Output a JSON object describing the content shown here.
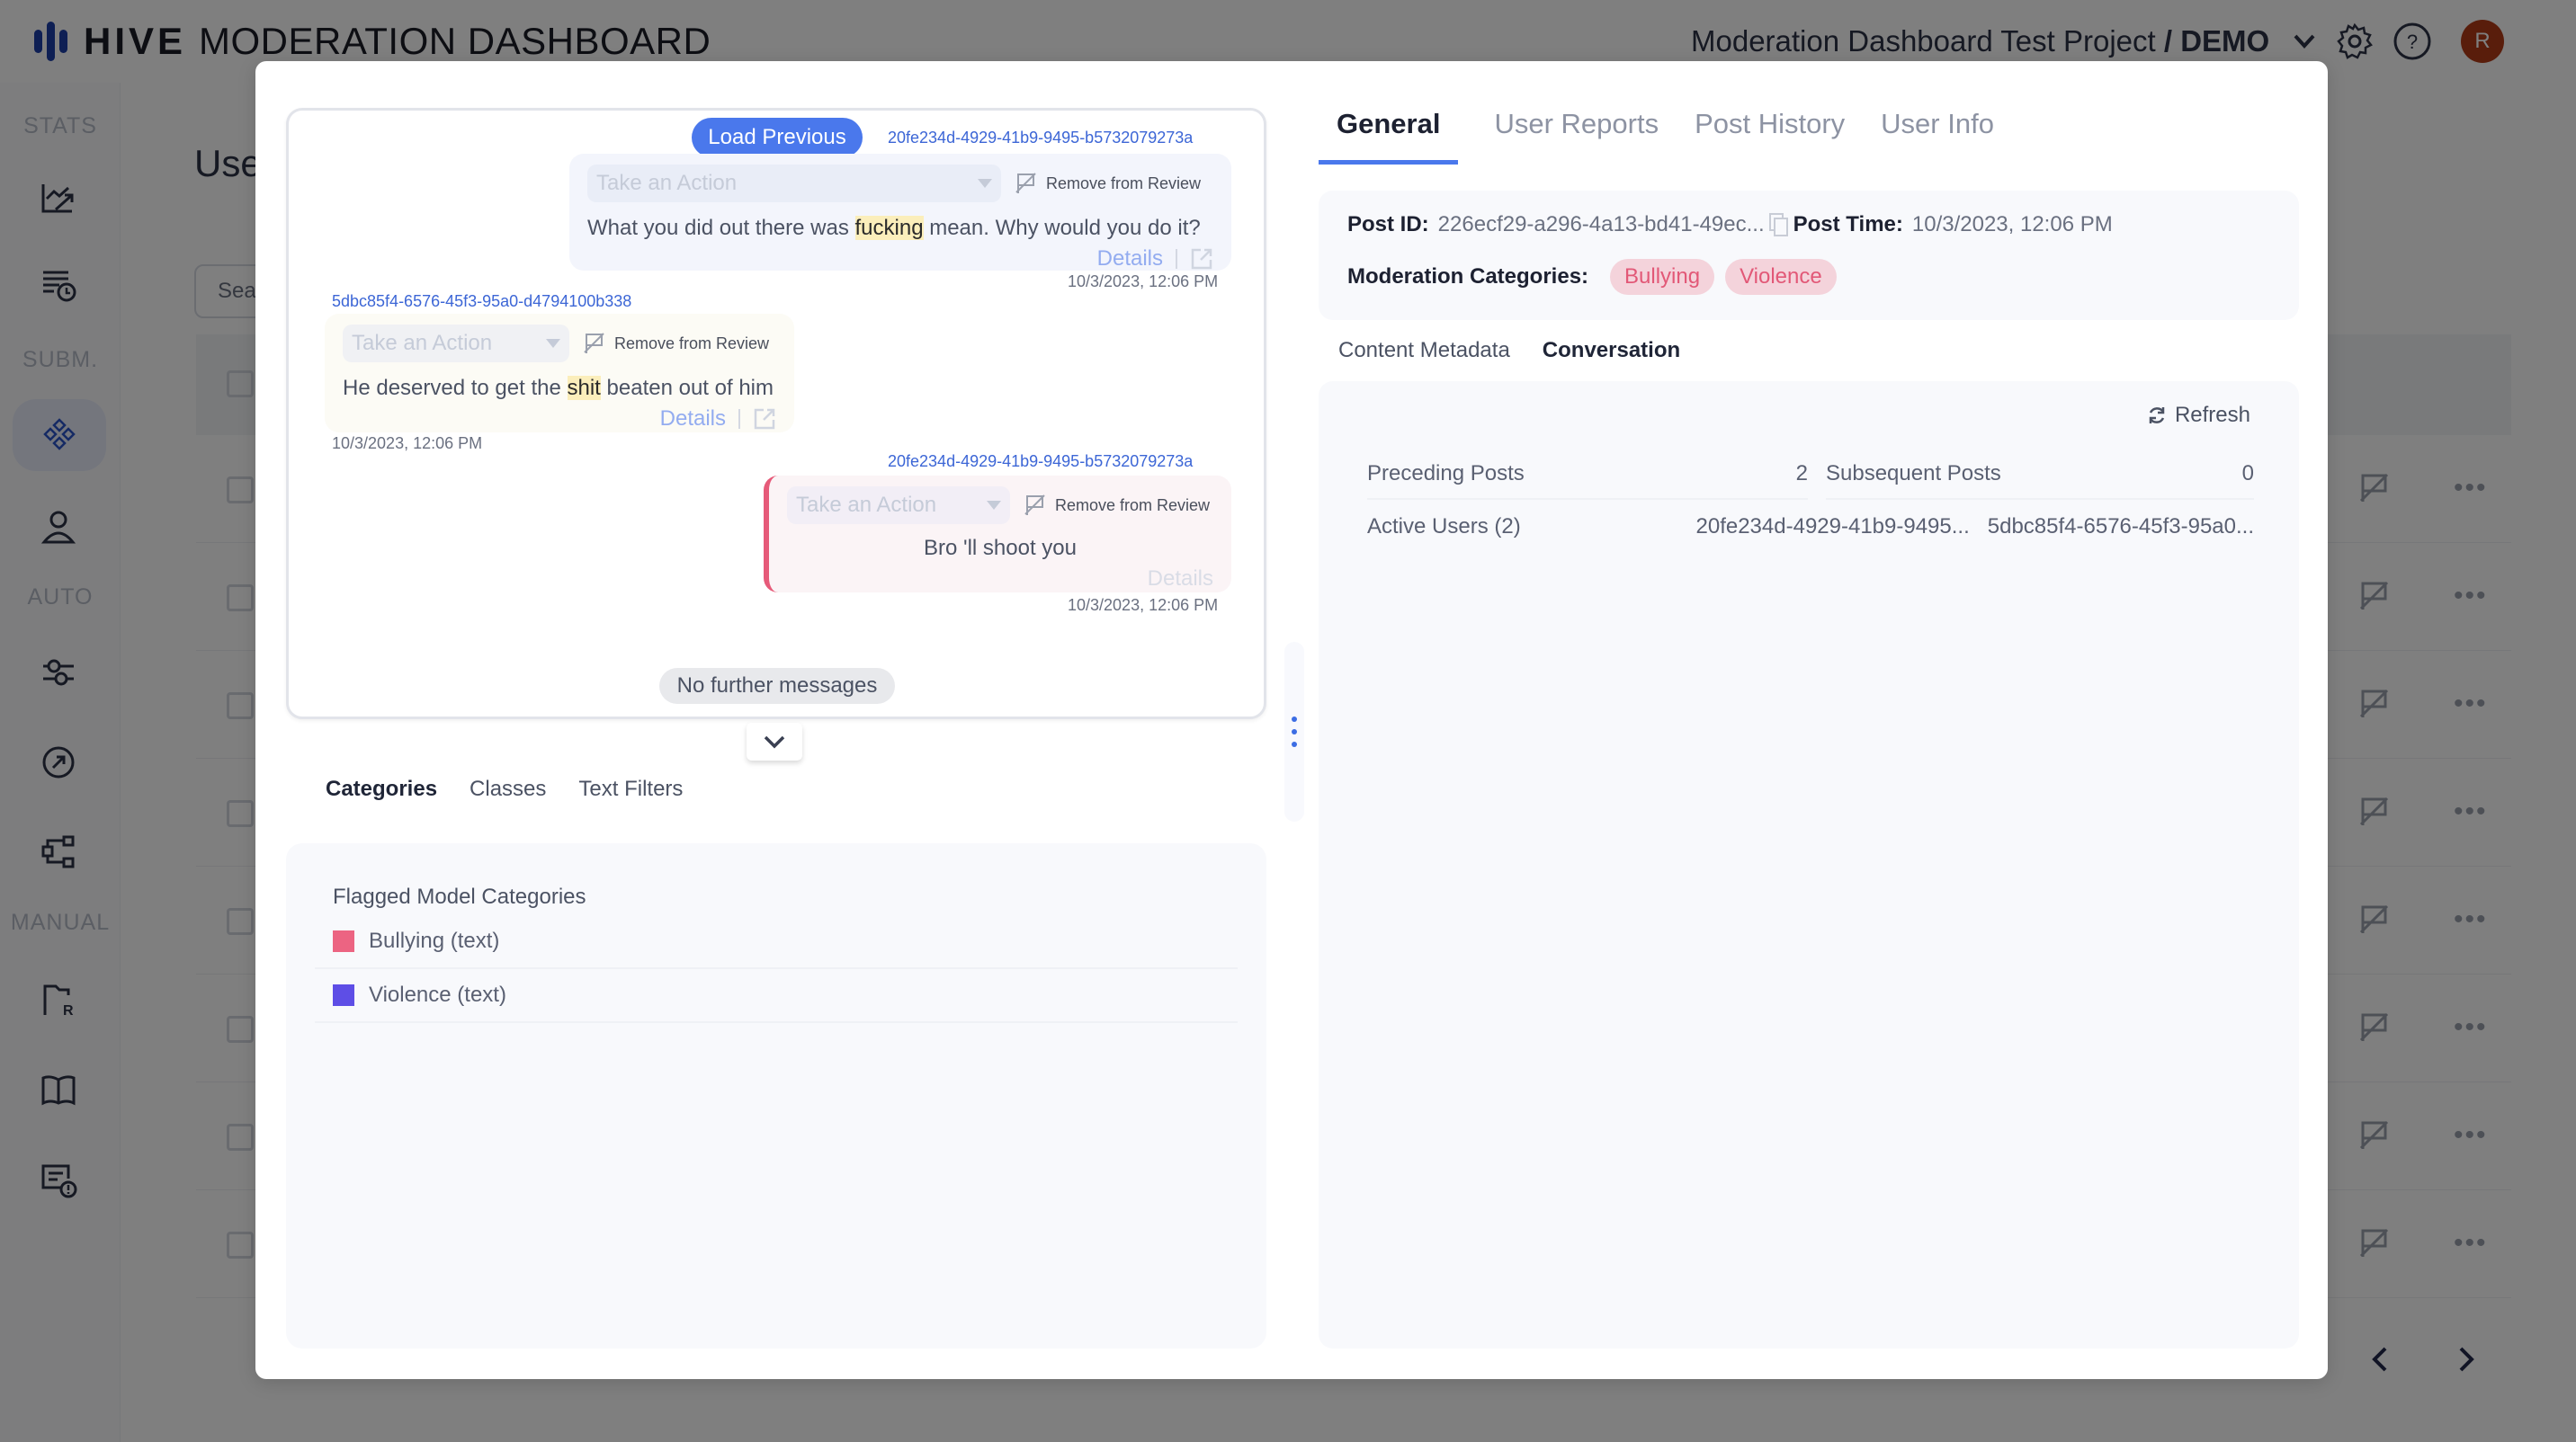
{
  "header": {
    "brand": "HIVE",
    "title": "MODERATION DASHBOARD",
    "project_name": "Moderation Dashboard Test Project",
    "project_separator": " / ",
    "project_env": "DEMO",
    "avatar_initial": "R",
    "avatar_color": "#b23a16"
  },
  "sidebar": {
    "sections": [
      {
        "label": "STATS",
        "items": [
          {
            "icon": "trend-chart-icon"
          },
          {
            "icon": "list-clock-icon"
          }
        ]
      },
      {
        "label": "SUBM.",
        "items": [
          {
            "icon": "diamonds-icon",
            "active": true
          },
          {
            "icon": "user-icon"
          }
        ]
      },
      {
        "label": "AUTO",
        "items": [
          {
            "icon": "sliders-icon"
          },
          {
            "icon": "arrow-circle-icon"
          },
          {
            "icon": "workflow-icon"
          }
        ]
      },
      {
        "label": "MANUAL",
        "items": [
          {
            "icon": "folder-r-icon"
          },
          {
            "icon": "book-icon"
          },
          {
            "icon": "report-alert-icon"
          }
        ]
      }
    ]
  },
  "background_page": {
    "title": "Use",
    "search_placeholder": "Sea"
  },
  "conversation": {
    "load_previous": "Load Previous",
    "messages": [
      {
        "user_id": "20fe234d-4929-41b9-9495-b5732079273a",
        "action_placeholder": "Take an Action",
        "remove_label": "Remove from Review",
        "text_before": "What you did out there was ",
        "highlight": "fucking",
        "text_after": " mean. Why would you do it?",
        "details": "Details",
        "timestamp": "10/3/2023, 12:06 PM",
        "side": "right"
      },
      {
        "user_id": "5dbc85f4-6576-45f3-95a0-d4794100b338",
        "action_placeholder": "Take an Action",
        "remove_label": "Remove from Review",
        "text_before": "He deserved to get the ",
        "highlight": "shit",
        "text_after": " beaten out of him",
        "details": "Details",
        "timestamp": "10/3/2023, 12:06 PM",
        "side": "left"
      },
      {
        "user_id": "20fe234d-4929-41b9-9495-b5732079273a",
        "action_placeholder": "Take an Action",
        "remove_label": "Remove from Review",
        "text": "Bro 'll shoot you",
        "details": "Details",
        "timestamp": "10/3/2023, 12:06 PM",
        "side": "right",
        "current": true
      }
    ],
    "no_more": "No further messages"
  },
  "left_tabs": [
    {
      "label": "Categories",
      "active": true
    },
    {
      "label": "Classes"
    },
    {
      "label": "Text Filters"
    }
  ],
  "categories": {
    "title": "Flagged Model Categories",
    "items": [
      {
        "label": "Bullying (text)",
        "color": "#ec6482"
      },
      {
        "label": "Violence (text)",
        "color": "#5e4ee6"
      }
    ]
  },
  "right_tabs": [
    {
      "label": "General",
      "active": true
    },
    {
      "label": "User Reports"
    },
    {
      "label": "Post History"
    },
    {
      "label": "User Info"
    }
  ],
  "general": {
    "post_id_label": "Post ID:",
    "post_id": "226ecf29-a296-4a13-bd41-49ec...",
    "post_time_label": "Post Time:",
    "post_time": "10/3/2023, 12:06 PM",
    "categories_label": "Moderation Categories:",
    "categories": [
      "Bullying",
      "Violence"
    ]
  },
  "sub_tabs": [
    {
      "label": "Content Metadata"
    },
    {
      "label": "Conversation",
      "active": true
    }
  ],
  "conversation_meta": {
    "refresh": "Refresh",
    "preceding_label": "Preceding Posts",
    "preceding_value": "2",
    "subsequent_label": "Subsequent Posts",
    "subsequent_value": "0",
    "active_users_label": "Active Users (2)",
    "active_users": [
      "20fe234d-4929-41b9-9495...",
      "5dbc85f4-6576-45f3-95a0..."
    ]
  },
  "colors": {
    "accent": "#4a78ec",
    "flag_pink": "#e65a79"
  }
}
